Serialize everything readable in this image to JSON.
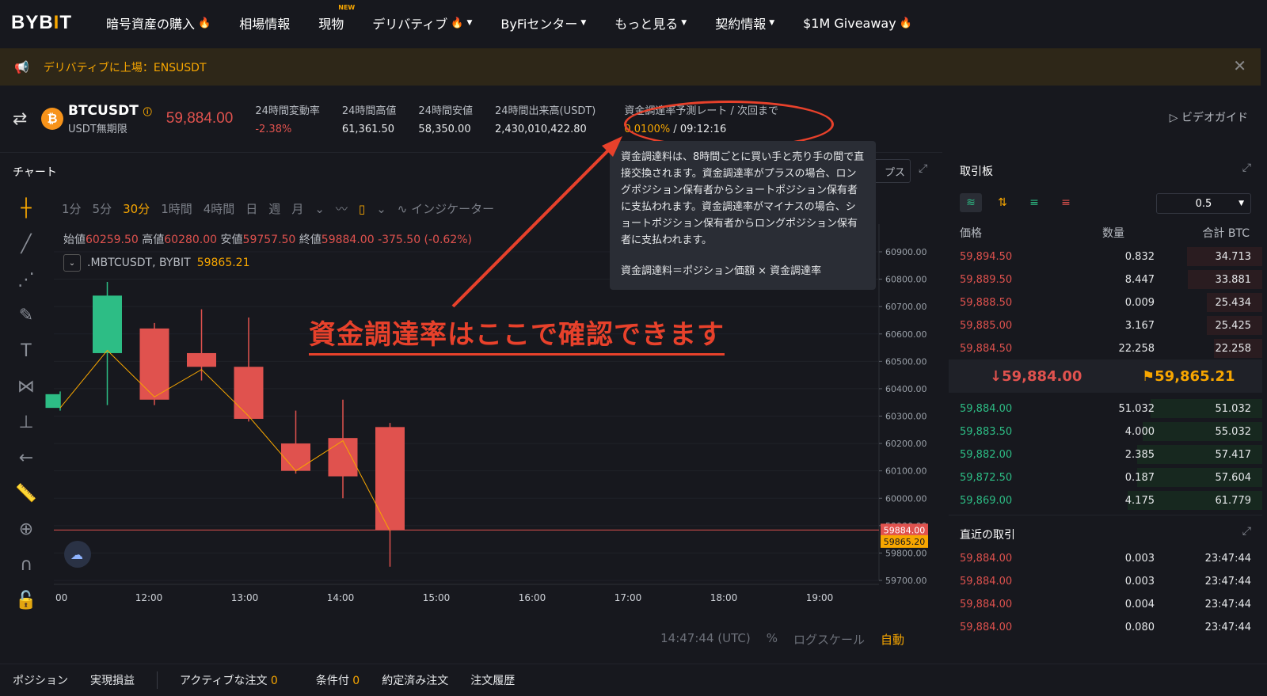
{
  "nav": {
    "logo_a": "BYB",
    "logo_i": "I",
    "logo_b": "T",
    "items": [
      {
        "label": "暗号資産の購入"
      },
      {
        "label": "相場情報"
      },
      {
        "label": "現物",
        "badge": "NEW"
      },
      {
        "label": "デリバティブ"
      },
      {
        "label": "ByFiセンター"
      },
      {
        "label": "もっと見る"
      },
      {
        "label": "契約情報"
      },
      {
        "label": "$1M Giveaway"
      }
    ]
  },
  "banner": {
    "text": "デリバティブに上場：ENSUSDT"
  },
  "ticker": {
    "symbol": "BTCUSDT",
    "subtitle": "USDT無期限",
    "last_price": "59,884.00",
    "change_label": "24時間変動率",
    "change_value": "-2.38%",
    "high_label": "24時間高値",
    "high_value": "61,361.50",
    "low_label": "24時間安値",
    "low_value": "58,350.00",
    "volume_label": "24時間出来高(USDT)",
    "volume_value": "2,430,010,422.80",
    "funding_label": "資金調達率予測レート / 次回まで",
    "funding_rate": "0.0100%",
    "funding_time": " / 09:12:16",
    "video_guide": "ビデオガイド"
  },
  "chart": {
    "title": "チャート",
    "timeframes": [
      "1分",
      "5分",
      "30分",
      "1時間",
      "4時間",
      "日",
      "週",
      "月"
    ],
    "indicator_label": "インジケーター",
    "ohlc": {
      "o_label": "始値",
      "o": "60259.50",
      "h_label": "高値",
      "h": "60280.00",
      "l_label": "安値",
      "l": "59757.50",
      "c_label": "終値",
      "c": "59884.00",
      "chg": "-375.50 (-0.62%)"
    },
    "mark_label": ".MBTCUSDT, BYBIT",
    "mark_value": "59865.21",
    "utc_time": "14:47:44 (UTC)",
    "pct": "%",
    "log_scale": "ログスケール",
    "auto": "自動",
    "cut_button": "プス"
  },
  "chart_data": {
    "type": "candlestick",
    "x": [
      "11:00",
      "11:30",
      "12:00",
      "12:30",
      "13:00",
      "13:30",
      "14:00",
      "14:30"
    ],
    "open": [
      60330,
      60530,
      60620,
      60530,
      60480,
      60200,
      60220,
      60260
    ],
    "close": [
      60380,
      60740,
      60360,
      60480,
      60290,
      60100,
      60080,
      59884
    ],
    "high": [
      60390,
      60790,
      60640,
      60690,
      60660,
      60320,
      60360,
      60275
    ],
    "low": [
      60320,
      60340,
      60340,
      60430,
      60280,
      60090,
      60000,
      59750
    ],
    "line": [
      60330,
      60540,
      60370,
      60470,
      60300,
      60100,
      60210,
      59880
    ],
    "y_ticks": [
      "60900.00",
      "60800.00",
      "60700.00",
      "60600.00",
      "60500.00",
      "60400.00",
      "60300.00",
      "60200.00",
      "60100.00",
      "60000.00",
      "59900.00",
      "59800.00",
      "59700.00"
    ],
    "x_ticks": [
      "00",
      "12:00",
      "13:00",
      "14:00",
      "15:00",
      "16:00",
      "17:00",
      "18:00",
      "19:00"
    ],
    "last_tag": "59884.00",
    "mark_tag": "59865.20",
    "ylim": [
      59700,
      60900
    ]
  },
  "tooltip": {
    "body": "資金調達料は、8時間ごとに買い手と売り手の間で直接交換されます。資金調達率がプラスの場合、ロングポジション保有者からショートポジション保有者に支払われます。資金調達率がマイナスの場合、ショートポジション保有者からロングポジション保有者に支払われます。",
    "formula": "資金調達料＝ポジション価額 × 資金調達率"
  },
  "callout": {
    "text": "資金調達率はここで確認できます"
  },
  "orderbook": {
    "title": "取引板",
    "depth": "0.5",
    "col_price": "価格",
    "col_qty": "数量",
    "col_total": "合計 BTC",
    "asks": [
      {
        "price": "59,894.50",
        "qty": "0.832",
        "total": "34.713",
        "fill": 0.56
      },
      {
        "price": "59,889.50",
        "qty": "8.447",
        "total": "33.881",
        "fill": 0.55
      },
      {
        "price": "59,888.50",
        "qty": "0.009",
        "total": "25.434",
        "fill": 0.41
      },
      {
        "price": "59,885.00",
        "qty": "3.167",
        "total": "25.425",
        "fill": 0.41
      },
      {
        "price": "59,884.50",
        "qty": "22.258",
        "total": "22.258",
        "fill": 0.36
      }
    ],
    "mid_last": "↓59,884.00",
    "mid_mark": "59,865.21",
    "bids": [
      {
        "price": "59,884.00",
        "qty": "51.032",
        "total": "51.032",
        "fill": 0.83
      },
      {
        "price": "59,883.50",
        "qty": "4.000",
        "total": "55.032",
        "fill": 0.89
      },
      {
        "price": "59,882.00",
        "qty": "2.385",
        "total": "57.417",
        "fill": 0.93
      },
      {
        "price": "59,872.50",
        "qty": "0.187",
        "total": "57.604",
        "fill": 0.93
      },
      {
        "price": "59,869.00",
        "qty": "4.175",
        "total": "61.779",
        "fill": 1.0
      }
    ]
  },
  "recent": {
    "title": "直近の取引",
    "rows": [
      {
        "price": "59,884.00",
        "qty": "0.003",
        "time": "23:47:44"
      },
      {
        "price": "59,884.00",
        "qty": "0.003",
        "time": "23:47:44"
      },
      {
        "price": "59,884.00",
        "qty": "0.004",
        "time": "23:47:44"
      },
      {
        "price": "59,884.00",
        "qty": "0.080",
        "time": "23:47:44"
      }
    ]
  },
  "bottom": {
    "positions": "ポジション",
    "realized": "実現損益",
    "active": "アクティブな注文",
    "active_count": "0",
    "conditional": "条件付",
    "conditional_count": "0",
    "filled": "約定済み注文",
    "history": "注文履歴"
  },
  "colors": {
    "up": "#2dbd85",
    "down": "#e0524e",
    "accent": "#f7a600",
    "annot": "#e8412b"
  }
}
